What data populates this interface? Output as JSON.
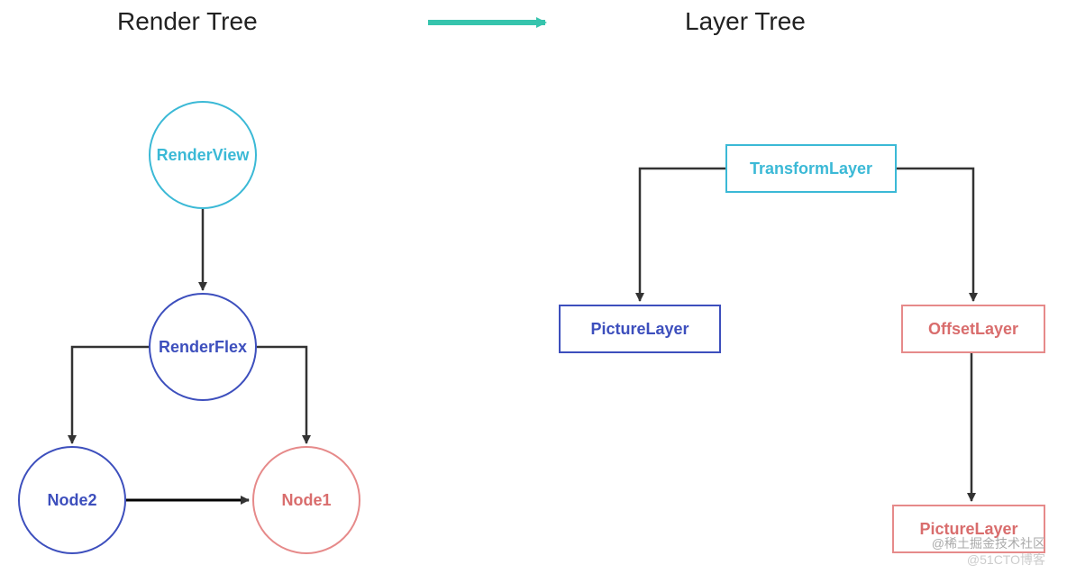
{
  "titles": {
    "left": "Render Tree",
    "right": "Layer Tree"
  },
  "render_tree": {
    "root": "RenderView",
    "child": "RenderFlex",
    "leaf_left": "Node2",
    "leaf_right": "Node1"
  },
  "layer_tree": {
    "root": "TransformLayer",
    "child_left": "PictureLayer",
    "child_right": "OffsetLayer",
    "grandchild": "PictureLayer"
  },
  "watermarks": {
    "line1": "@稀土掘金技术社区",
    "line2": "@51CTO博客"
  },
  "colors": {
    "cyan": "#3bb9d6",
    "blue": "#3d4fbd",
    "pink": "#e68a8a",
    "arrow_teal": "#36c4ad",
    "arrow_dark": "#333333"
  }
}
